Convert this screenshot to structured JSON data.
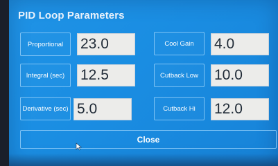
{
  "title": "PID Loop Parameters",
  "left_params": [
    {
      "label": "Proportional",
      "value": "23.0"
    },
    {
      "label": "Integral (sec)",
      "value": "12.5"
    },
    {
      "label": "Derivative (sec)",
      "value": "5.0"
    }
  ],
  "right_params": [
    {
      "label": "Cool Gain",
      "value": "4.0"
    },
    {
      "label": "Cutback Low",
      "value": "10.0"
    },
    {
      "label": "Cutback Hi",
      "value": "12.0"
    }
  ],
  "close_label": "Close",
  "colors": {
    "panel": "#1a8de2",
    "field_bg": "#ececea",
    "border": "#7ec3f5"
  }
}
